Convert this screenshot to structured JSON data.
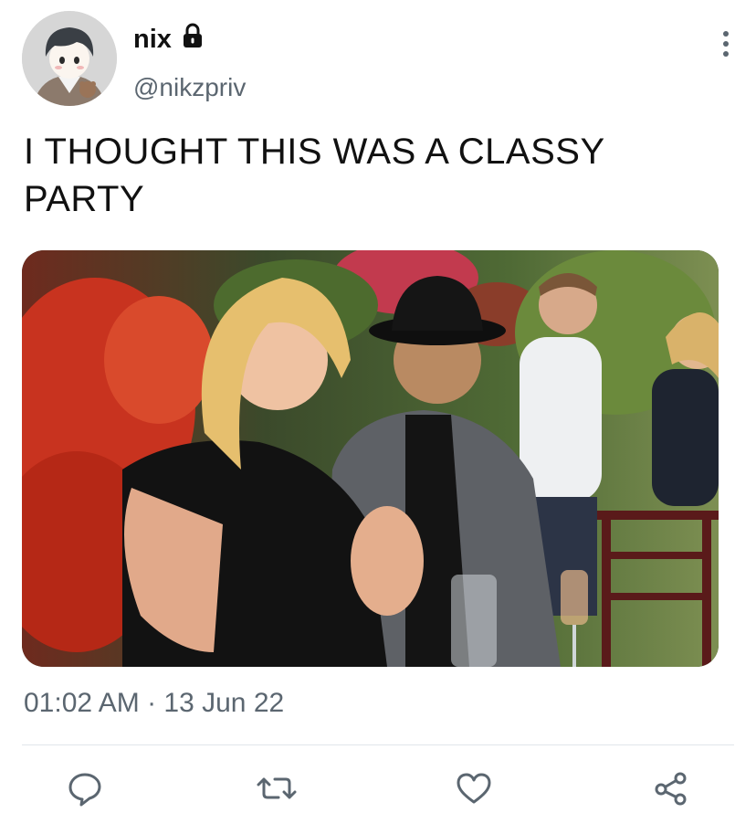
{
  "user": {
    "display_name": "nix",
    "handle": "@nikzpriv",
    "protected_icon": "lock-icon",
    "avatar": "illustrated-avatar"
  },
  "tweet": {
    "text": "I THOUGHT THIS WAS A CLASSY PARTY",
    "media_description": "video still of party guests",
    "timestamp": "01:02 AM · 13 Jun 22"
  },
  "actions": [
    {
      "name": "reply",
      "icon": "speech-bubble-icon"
    },
    {
      "name": "retweet",
      "icon": "retweet-icon"
    },
    {
      "name": "like",
      "icon": "heart-icon"
    },
    {
      "name": "share",
      "icon": "share-icon"
    }
  ],
  "colors": {
    "text": "#111111",
    "secondary_text": "#5b6670",
    "divider": "#e1e6ea",
    "icon": "#5b6670"
  }
}
